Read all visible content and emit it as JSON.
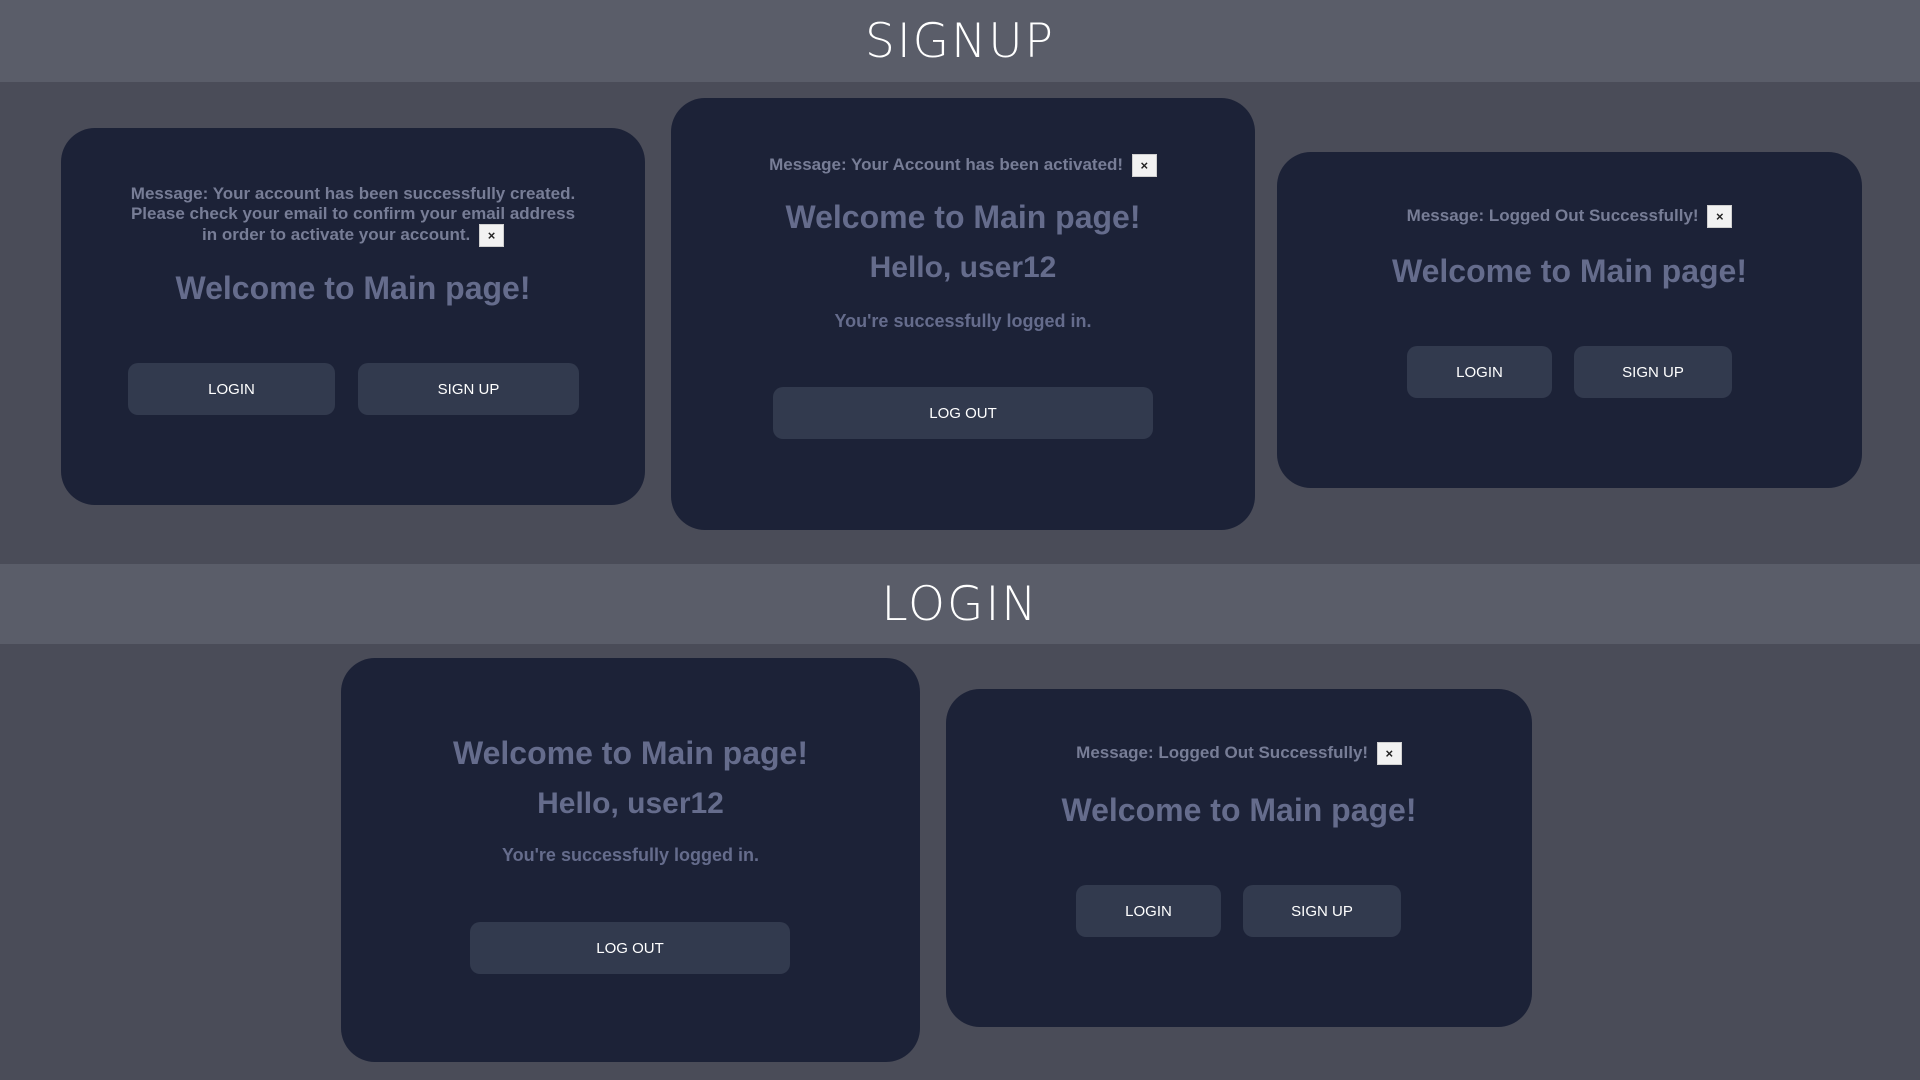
{
  "sections": {
    "signup_title": "SIGNUP",
    "login_title": "LOGIN"
  },
  "close_symbol": "×",
  "cards": [
    {
      "message_line1": "Message: Your account has been successfully created.",
      "message_line2": "Please check your email to confirm your email address",
      "message_line3": "in order to activate your account.",
      "welcome": "Welcome to Main page!",
      "login_label": "LOGIN",
      "signup_label": "SIGN UP"
    },
    {
      "message": "Message: Your Account has been activated!",
      "welcome": "Welcome to Main page!",
      "hello": "Hello, user12",
      "logged_in": "You're successfully logged in.",
      "logout_label": "LOG OUT"
    },
    {
      "message": "Message: Logged Out Successfully!",
      "welcome": "Welcome to Main page!",
      "login_label": "LOGIN",
      "signup_label": "SIGN UP"
    },
    {
      "welcome": "Welcome to Main page!",
      "hello": "Hello, user12",
      "logged_in": "You're successfully logged in.",
      "logout_label": "LOG OUT"
    },
    {
      "message": "Message: Logged Out Successfully!",
      "welcome": "Welcome to Main page!",
      "login_label": "LOGIN",
      "signup_label": "SIGN UP"
    }
  ],
  "colors": {
    "page_background": "#4a4c58",
    "band_background": "#5a5d69",
    "card_background": "#1c2237",
    "button_background": "#323a4e",
    "message_text": "#777d96",
    "heading_text": "#656c8c"
  }
}
